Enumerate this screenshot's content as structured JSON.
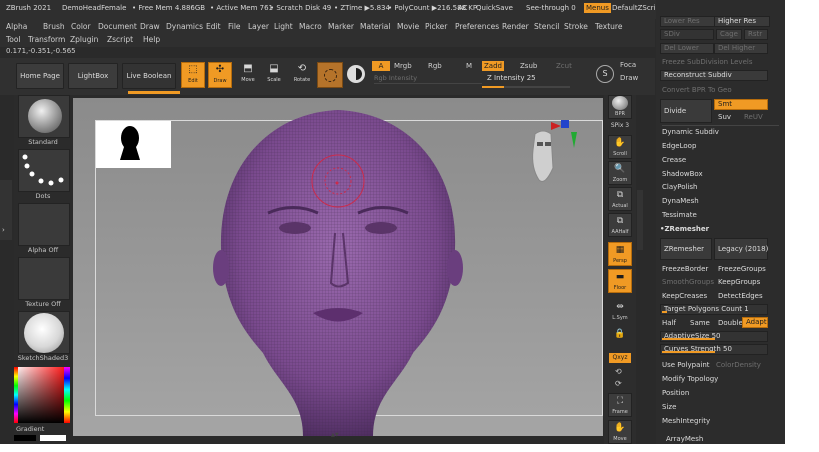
{
  "titlebar": {
    "app": "ZBrush 2021",
    "doc": "DemoHeadFemale",
    "free_mem": "• Free Mem 4.886GB",
    "active_mem": "• Active Mem 761",
    "scratch": "• Scratch Disk 49",
    "ztime": "• ZTime ▶5.834",
    "polycount": "• PolyCount ▶216.588 KP",
    "ac": "AC",
    "quicksave": "QuickSave",
    "see_through": "See-through  0",
    "menus": "Menus",
    "default_zscript": "DefaultZScript"
  },
  "menubar": {
    "row1": [
      "Alpha",
      "Brush",
      "Color",
      "Document",
      "Draw",
      "Dynamics",
      "Edit",
      "File",
      "Layer",
      "Light",
      "Macro",
      "Marker",
      "Material",
      "Movie",
      "Picker",
      "Preferences",
      "Render",
      "Stencil",
      "Stroke",
      "Texture"
    ],
    "row2": [
      "Tool",
      "Transform",
      "Zplugin",
      "Zscript",
      "Help"
    ]
  },
  "coords": "0.171,-0.351,-0.565",
  "toolbar": {
    "home_page": "Home Page",
    "lightbox": "LightBox",
    "live_boolean": "Live Boolean",
    "edit": "Edit",
    "draw": "Draw",
    "move": "Move",
    "scale": "Scale",
    "rotate": "Rotate",
    "a": "A",
    "mrgb": "Mrgb",
    "rgb": "Rgb",
    "m": "M",
    "zadd": "Zadd",
    "zsub": "Zsub",
    "zcut": "Zcut",
    "rgb_intensity": "Rgb Intensity",
    "z_intensity": "Z Intensity 25",
    "z_intensity_value": 0.25,
    "focal": "Foca",
    "draw_size": "Draw",
    "s_label": "S"
  },
  "leftshelf": {
    "standard": "Standard",
    "dots": "Dots",
    "alpha_off": "Alpha Off",
    "texture_off": "Texture Off",
    "material": "SketchShaded3",
    "gradient": "Gradient"
  },
  "rightshelf": {
    "bpr": "BPR",
    "spix": "SPix 3",
    "scroll": "Scroll",
    "zoom": "Zoom",
    "actual": "Actual",
    "aahalf": "AAHalf",
    "persp": "Persp",
    "floor": "Floor",
    "lsym": "L.Sym",
    "xyz": "Qxyz",
    "frame": "Frame",
    "move": "Move"
  },
  "panel": {
    "lower_res": "Lower Res",
    "higher_res": "Higher Res",
    "sdiv": "SDiv",
    "cage": "Cage",
    "rstr": "Rstr",
    "del_lower": "Del Lower",
    "del_higher": "Del Higher",
    "freeze_subdiv": "Freeze SubDivision Levels",
    "reconstruct": "Reconstruct Subdiv",
    "convert_bpr": "Convert BPR To Geo",
    "divide": "Divide",
    "smt": "Smt",
    "suv": "Suv",
    "reuv": "ReUV",
    "dynamic_subdiv": "Dynamic Subdiv",
    "edgeloop": "EdgeLoop",
    "crease": "Crease",
    "shadowbox": "ShadowBox",
    "claypolish": "ClayPolish",
    "dynamesh": "DynaMesh",
    "tessimate": "Tessimate",
    "zremesher_header": "ZRemesher",
    "zremesher": "ZRemesher",
    "legacy": "Legacy (2018)",
    "freezeborder": "FreezeBorder",
    "freezegroups": "FreezeGroups",
    "smoothgroups": "SmoothGroups",
    "keepgroups": "KeepGroups",
    "keepcreases": "KeepCreases",
    "detectedges": "DetectEdges",
    "target_poly": "Target Polygons Count 1",
    "target_poly_value": 0.05,
    "half": "Half",
    "same": "Same",
    "double": "Double",
    "adapt": "Adapt",
    "adaptive_size": "AdaptiveSize 50",
    "adaptive_size_value": 0.5,
    "curves_strength": "Curves Strength 50",
    "curves_strength_value": 0.5,
    "use_polypaint": "Use Polypaint",
    "color_density": "ColorDensity",
    "modify_topology": "Modify Topology",
    "position": "Position",
    "size": "Size",
    "meshintegrity": "MeshIntegrity",
    "arraymesh": "ArrayMesh"
  },
  "colors": {
    "accent": "#f09a24",
    "mesh": "#7a4a8e",
    "background": "#2a2a2a"
  }
}
